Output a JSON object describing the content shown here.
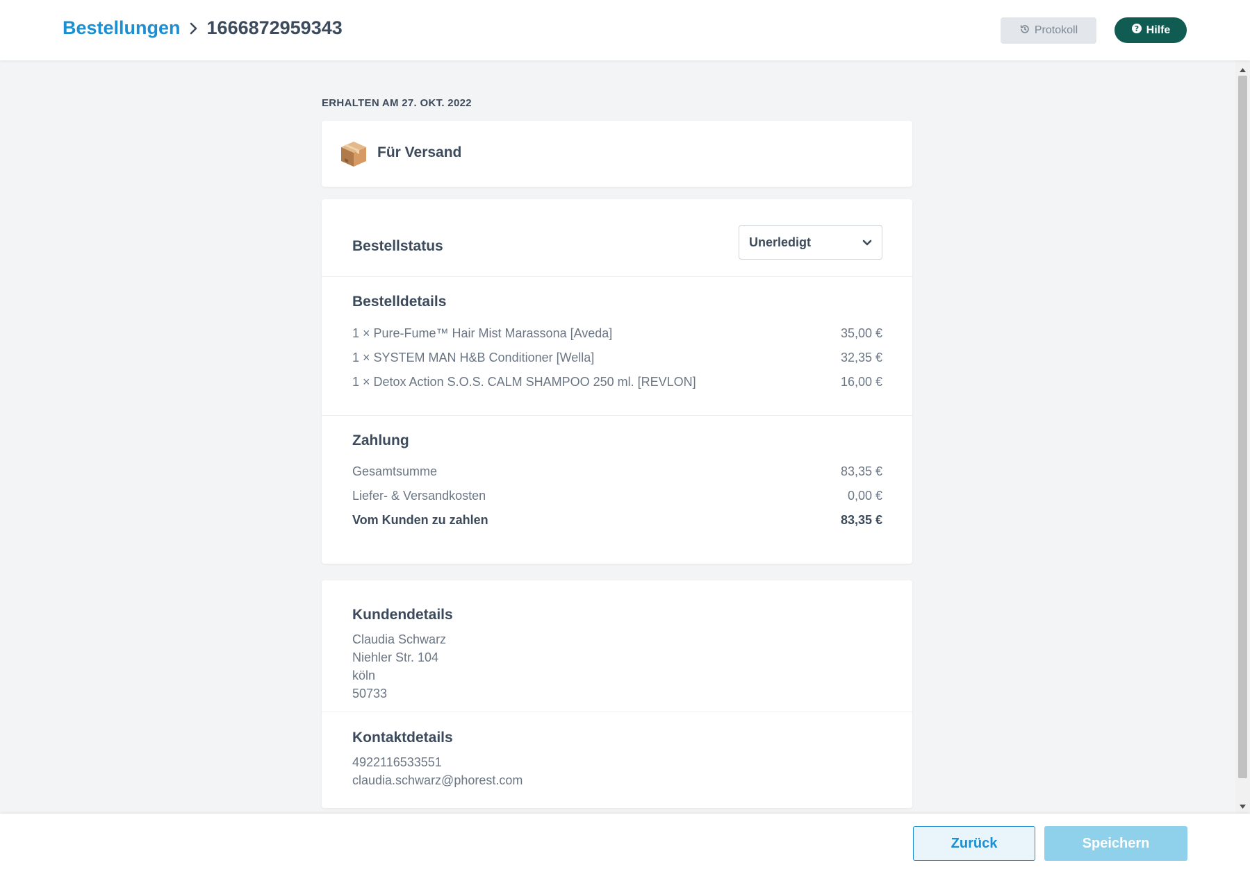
{
  "header": {
    "breadcrumb_root": "Bestellungen",
    "order_id": "1666872959343",
    "protokoll_label": "Protokoll",
    "hilfe_label": "Hilfe"
  },
  "order": {
    "received_label": "ERHALTEN AM 27. OKT. 2022",
    "delivery_type": "Für Versand",
    "status_title": "Bestellstatus",
    "status_value": "Unerledigt",
    "details_title": "Bestelldetails",
    "items": [
      {
        "label": "1 × Pure-Fume™ Hair Mist Marassona [Aveda]",
        "price": "35,00 €"
      },
      {
        "label": "1 × SYSTEM MAN H&B Conditioner [Wella]",
        "price": "32,35 €"
      },
      {
        "label": "1 × Detox Action S.O.S. CALM SHAMPOO 250 ml. [REVLON]",
        "price": "16,00 €"
      }
    ],
    "payment_title": "Zahlung",
    "payment": [
      {
        "label": "Gesamtsumme",
        "value": "83,35 €"
      },
      {
        "label": "Liefer- & Versandkosten",
        "value": "0,00 €"
      },
      {
        "label": "Vom Kunden zu zahlen",
        "value": "83,35 €"
      }
    ]
  },
  "customer": {
    "title": "Kundendetails",
    "name": "Claudia Schwarz",
    "street": "Niehler Str. 104",
    "city": "köln",
    "zip": "50733",
    "contact_title": "Kontaktdetails",
    "phone": "4922116533551",
    "email": "claudia.schwarz@phorest.com"
  },
  "footer": {
    "back_label": "Zurück",
    "save_label": "Speichern"
  },
  "icons": {
    "breadcrumb_separator": "chevron-right-icon",
    "protokoll": "history-icon",
    "hilfe": "question-circle-icon",
    "versand": "package-box-icon",
    "select": "chevron-down-icon"
  },
  "colors": {
    "link_blue": "#1b8fd1",
    "help_green": "#105c53",
    "save_disabled": "#8fd0ea",
    "background": "#f3f4f6"
  }
}
